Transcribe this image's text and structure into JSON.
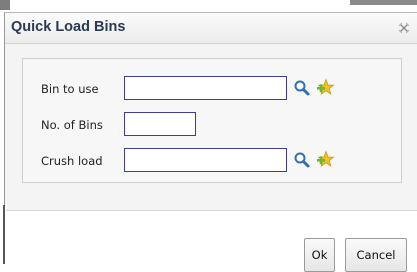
{
  "dialog": {
    "title": "Quick Load Bins",
    "close_icon": "close-icon"
  },
  "form": {
    "bin_to_use": {
      "label": "Bin to use",
      "value": "",
      "search_icon": "magnifier-icon",
      "add_icon": "add-star-icon"
    },
    "no_of_bins": {
      "label": "No. of Bins",
      "value": ""
    },
    "crush_load": {
      "label": "Crush load",
      "value": "",
      "search_icon": "magnifier-icon",
      "add_icon": "add-star-icon"
    }
  },
  "footer": {
    "ok_label": "Ok",
    "cancel_label": "Cancel"
  },
  "colors": {
    "title_text": "#2a3a52",
    "field_border": "#3e3e9a",
    "panel_bg": "#f4f4f4",
    "add_icon_green": "#6fb53a",
    "add_icon_yellow": "#f2c21b",
    "search_icon_blue": "#2f6fb7"
  }
}
